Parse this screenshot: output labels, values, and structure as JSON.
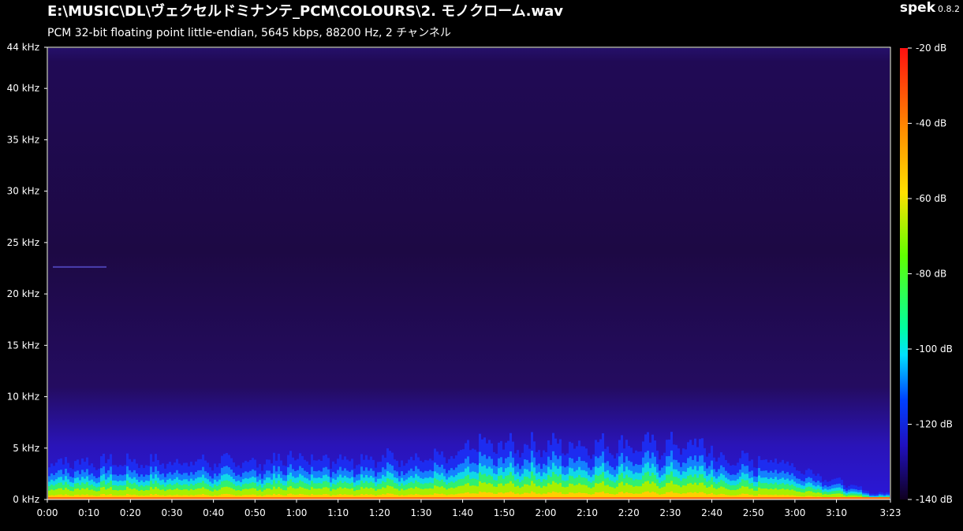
{
  "header": {
    "file_path": "E:\\MUSIC\\DL\\ヴェクセルドミナンテ_PCM\\COLOURS\\2. モノクローム.wav",
    "stream_info": "PCM 32-bit floating point little-endian, 5645 kbps, 88200 Hz, 2 チャンネル"
  },
  "brand": {
    "name": "spek",
    "version": "0.8.2"
  },
  "axes": {
    "frequency_ticks": [
      "0 kHz",
      "5 kHz",
      "10 kHz",
      "15 kHz",
      "20 kHz",
      "25 kHz",
      "30 kHz",
      "35 kHz",
      "40 kHz",
      "44 kHz"
    ],
    "time_ticks": [
      "0:00",
      "0:10",
      "0:20",
      "0:30",
      "0:40",
      "0:50",
      "1:00",
      "1:10",
      "1:20",
      "1:30",
      "1:40",
      "1:50",
      "2:00",
      "2:10",
      "2:20",
      "2:30",
      "2:40",
      "2:50",
      "3:00",
      "3:10",
      "3:23"
    ],
    "db_ticks": [
      "-20 dB",
      "-40 dB",
      "-60 dB",
      "-80 dB",
      "-100 dB",
      "-120 dB",
      "-140 dB"
    ]
  },
  "spectrogram": {
    "duration_seconds": 203,
    "max_frequency_khz": 44,
    "background_color": "#1e0a4a",
    "colormap": [
      "#ff1010",
      "#ff8c00",
      "#ffe000",
      "#80ff00",
      "#00ff80",
      "#00e0ff",
      "#0050ff",
      "#2010d0",
      "#200a50",
      "#050010"
    ]
  }
}
